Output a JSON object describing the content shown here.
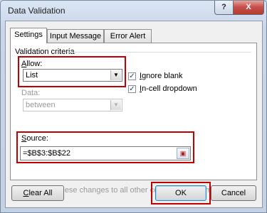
{
  "window": {
    "title": "Data Validation",
    "help_glyph": "?",
    "close_glyph": "X"
  },
  "tabs": [
    {
      "label": "Settings",
      "active": true
    },
    {
      "label": "Input Message",
      "active": false
    },
    {
      "label": "Error Alert",
      "active": false
    }
  ],
  "criteria": {
    "group_title": "Validation criteria",
    "allow_label_accel": "A",
    "allow_label_rest": "llow:",
    "allow_value": "List",
    "data_label": "Data:",
    "data_value": "between",
    "ignore_blank_accel": "I",
    "ignore_blank_rest": "gnore blank",
    "ignore_blank_checked": true,
    "incell_accel": "I",
    "incell_rest": "n-cell dropdown",
    "incell_checked": true,
    "source_label_accel": "S",
    "source_label_rest": "ource:",
    "source_value": "=$B$3:$B$22"
  },
  "apply_all": {
    "label": "Apply these changes to all other cells with the same settings",
    "checked": false
  },
  "buttons": {
    "clear_all_accel": "C",
    "clear_all_rest": "lear All",
    "ok": "OK",
    "cancel": "Cancel"
  },
  "colors": {
    "highlight": "#c00000"
  }
}
